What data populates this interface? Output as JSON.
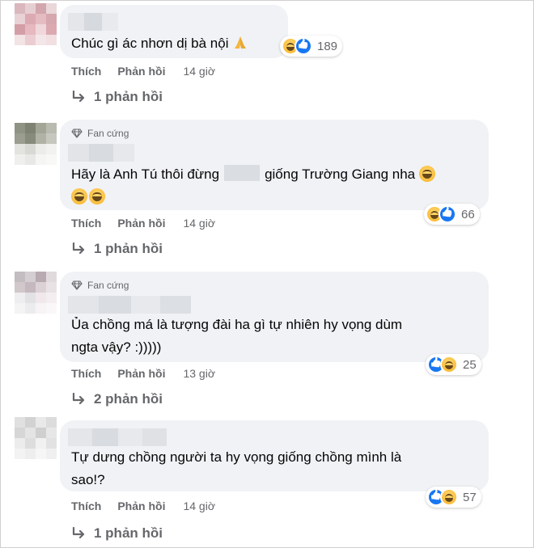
{
  "comments": [
    {
      "badge": "",
      "text": "Chúc gì ác nhơn dị bà nội",
      "reaction_count": "189",
      "reaction_icons": [
        "haha-icon",
        "like-icon"
      ],
      "like_label": "Thích",
      "reply_label": "Phản hồi",
      "time": "14 giờ",
      "replies_label": "1 phản hồi"
    },
    {
      "badge": "Fan cứng",
      "text_before": "Hãy là Anh Tú thôi đừng",
      "text_after": "giống Trường Giang nha",
      "reaction_count": "66",
      "reaction_icons": [
        "haha-icon",
        "like-icon"
      ],
      "like_label": "Thích",
      "reply_label": "Phản hồi",
      "time": "14 giờ",
      "replies_label": "1 phản hồi"
    },
    {
      "badge": "Fan cứng",
      "text_line1": "Ủa chồng má là tượng đài ha gì tự nhiên hy vọng dùm",
      "text_line2": "ngta vậy? :)))))",
      "reaction_count": "25",
      "reaction_icons": [
        "like-icon",
        "haha-icon"
      ],
      "like_label": "Thích",
      "reply_label": "Phản hồi",
      "time": "13 giờ",
      "replies_label": "2 phản hồi"
    },
    {
      "badge": "",
      "text_line1": "Tự dưng chồng người ta hy vọng giống chồng mình là",
      "text_line2": "sao!?",
      "reaction_count": "57",
      "reaction_icons": [
        "like-icon",
        "haha-icon"
      ],
      "like_label": "Thích",
      "reply_label": "Phản hồi",
      "time": "14 giờ",
      "replies_label": "1 phản hồi"
    }
  ],
  "colors": {
    "bubble": "#f0f2f5",
    "meta_text": "#65676b",
    "like_blue": "#1877f2",
    "haha_yellow": "#f7b125"
  }
}
